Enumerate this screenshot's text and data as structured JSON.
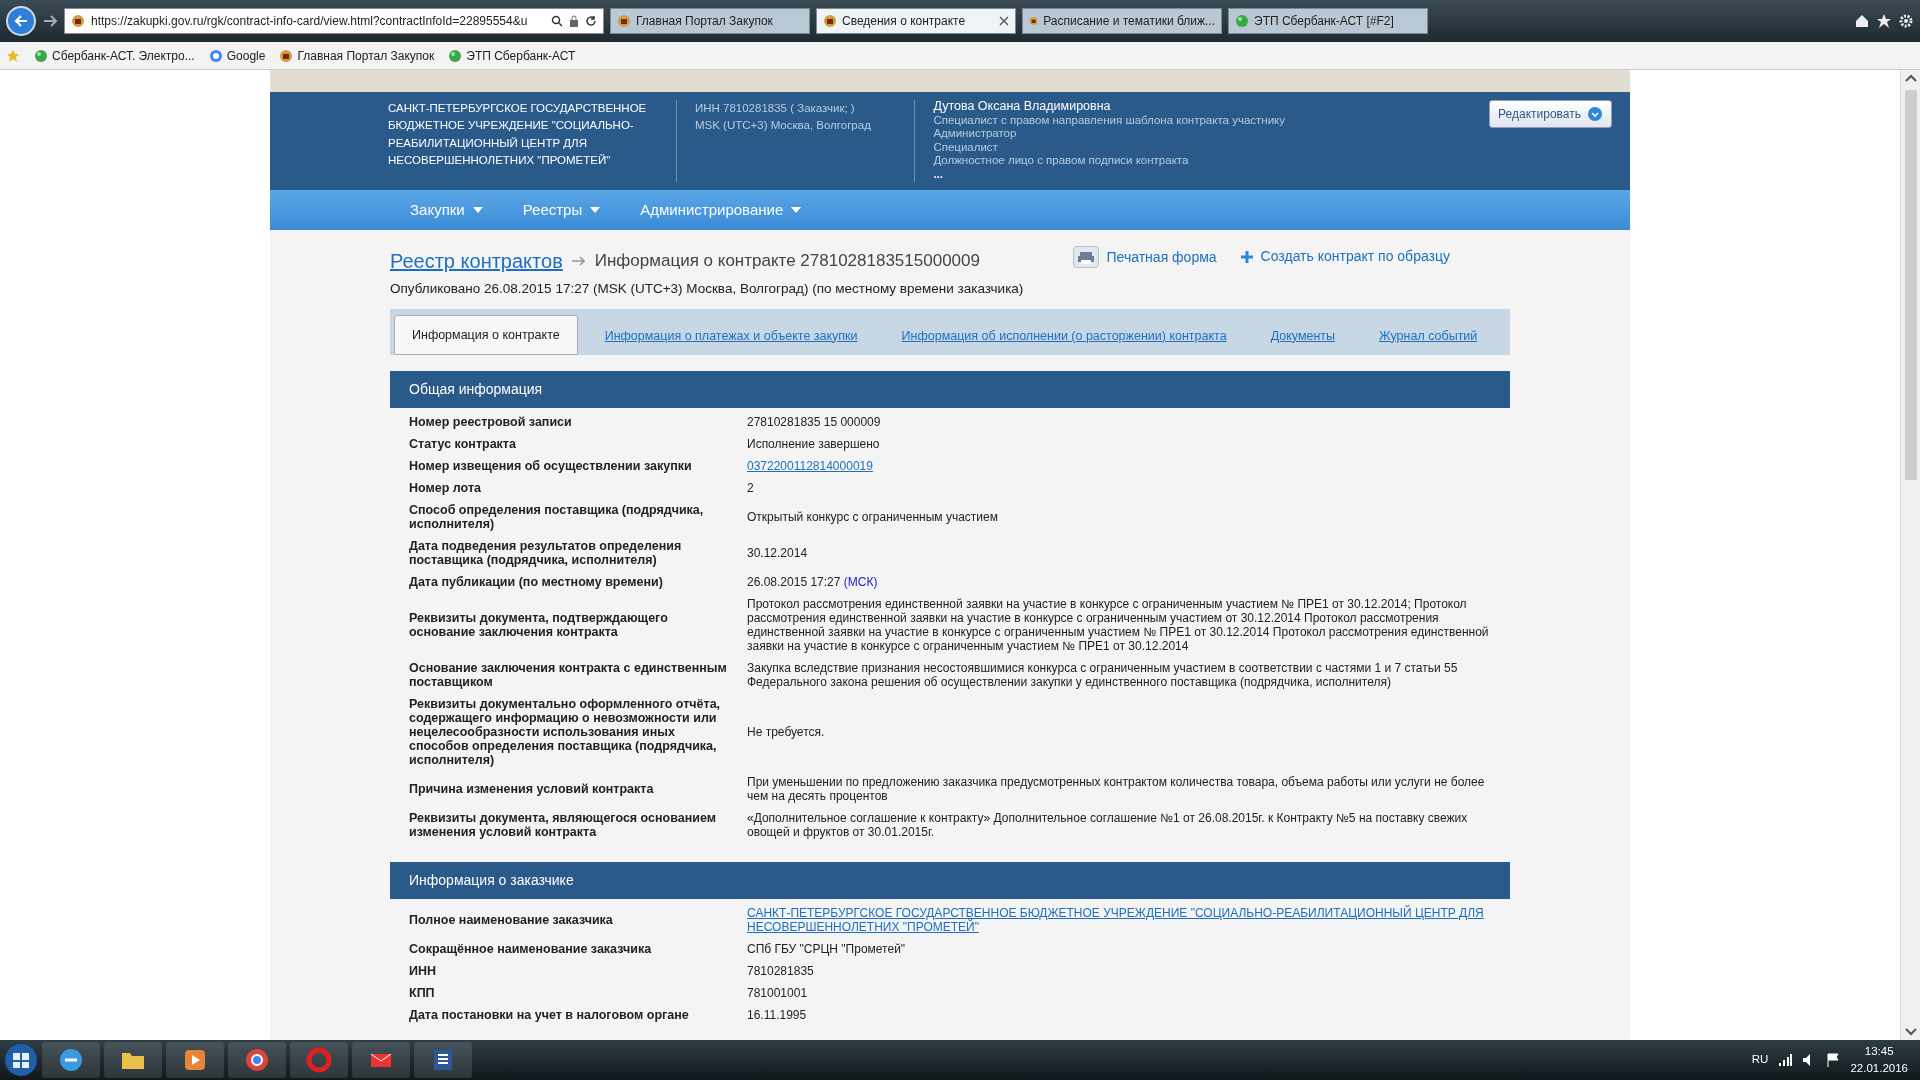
{
  "browser": {
    "url": "https://zakupki.gov.ru/rgk/contract-info-card/view.html?contractInfoId=22895554&u",
    "tabs": [
      {
        "title": "Главная Портал Закупок",
        "selected": false
      },
      {
        "title": "Сведения о контракте",
        "selected": true
      },
      {
        "title": "Расписание и тематики ближ...",
        "selected": false
      },
      {
        "title": "ЭТП Сбербанк-АСТ [#F2]",
        "selected": false
      }
    ],
    "favorites": [
      "Сбербанк-АСТ. Электро...",
      "Google",
      "Главная Портал Закупок",
      "ЭТП Сбербанк-АСТ"
    ]
  },
  "header": {
    "org": "САНКТ-ПЕТЕРБУРГСКОЕ ГОСУДАРСТВЕННОЕ БЮДЖЕТНОЕ УЧРЕЖДЕНИЕ \"СОЦИАЛЬНО-РЕАБИЛИТАЦИОННЫЙ ЦЕНТР ДЛЯ НЕСОВЕРШЕННОЛЕТНИХ \"ПРОМЕТЕЙ\"",
    "inn": "ИНН 7810281835 ( Заказчик; )",
    "timezone": "MSK (UTC+3) Москва, Волгоград",
    "user": "Дутова Оксана Владимировна",
    "roles": [
      "Специалист с правом направления шаблона контракта участнику",
      "Администратор",
      "Специалист",
      "Должностное лицо с правом подписи контракта"
    ],
    "more": "...",
    "edit_button": "Редактировать"
  },
  "nav": [
    "Закупки",
    "Реестры",
    "Администрирование"
  ],
  "breadcrumb": {
    "link": "Реестр контрактов",
    "current": "Информация о контракте 2781028183515000009"
  },
  "published": "Опубликовано 26.08.2015 17:27 (MSK (UTC+3) Москва, Волгоград) (по местному времени заказчика)",
  "actions": [
    {
      "kind": "print",
      "label": "Печатная форма"
    },
    {
      "kind": "create",
      "label": "Создать контракт по образцу"
    }
  ],
  "tabs": [
    {
      "label": "Информация о контракте",
      "selected": true
    },
    {
      "label": "Информация о платежах и объекте закупки",
      "selected": false
    },
    {
      "label": "Информация об исполнении (о расторжении) контракта",
      "selected": false
    },
    {
      "label": "Документы",
      "selected": false
    },
    {
      "label": "Журнал событий",
      "selected": false
    }
  ],
  "sections": [
    {
      "title": "Общая информация",
      "rows": [
        {
          "label": "Номер реестровой записи",
          "kind": "text",
          "value": "27810281835 15 000009"
        },
        {
          "label": "Статус контракта",
          "kind": "text",
          "value": "Исполнение завершено"
        },
        {
          "label": "Номер извещения об осуществлении закупки",
          "kind": "link",
          "value": "0372200112814000019"
        },
        {
          "label": "Номер лота",
          "kind": "text",
          "value": "2"
        },
        {
          "label": "Способ определения поставщика (подрядчика, исполнителя)",
          "kind": "text",
          "value": "Открытый конкурс с ограниченным участием"
        },
        {
          "label": "Дата подведения результатов определения поставщика (подрядчика, исполнителя)",
          "kind": "text",
          "value": "30.12.2014"
        },
        {
          "label": "Дата публикации (по местному времени)",
          "kind": "time",
          "value": "26.08.2015 17:27",
          "zone": "(МСК)"
        },
        {
          "label": "Реквизиты документа, подтверждающего основание заключения контракта",
          "kind": "text",
          "value": "Протокол рассмотрения единственной заявки на участие в конкурсе с ограниченным участием № ПРЕ1 от 30.12.2014; Протокол рассмотрения единственной заявки на участие в конкурсе с ограниченным участием от 30.12.2014 Протокол рассмотрения единственной заявки на участие в конкурсе с ограниченным участием № ПРЕ1 от 30.12.2014 Протокол рассмотрения единственной заявки на участие в конкурсе с ограниченным участием № ПРЕ1 от 30.12.2014"
        },
        {
          "label": "Основание заключения контракта с единственным поставщиком",
          "kind": "text",
          "value": "Закупка вследствие признания несостоявшимися конкурса с ограниченным участием в соответствии с частями 1 и 7 статьи 55 Федерального закона решения об осуществлении закупки у единственного поставщика (подрядчика, исполнителя)"
        },
        {
          "label": "Реквизиты документально оформленного отчёта, содержащего информацию о невозможности или нецелесообразности использования иных способов определения поставщика (подрядчика, исполнителя)",
          "kind": "text",
          "value": "Не требуется."
        },
        {
          "label": "Причина изменения условий контракта",
          "kind": "text",
          "value": "При уменьшении по предложению заказчика предусмотренных контрактом количества товара, объема работы или услуги не более чем на десять процентов"
        },
        {
          "label": "Реквизиты документа, являющегося основанием изменения условий контракта",
          "kind": "text",
          "value": "«Дополнительное соглашение к контракту» Дополнительное соглашение №1 от 26.08.2015г. к Контракту №5 на поставку свежих овощей и фруктов от 30.01.2015г."
        }
      ]
    },
    {
      "title": "Информация о заказчике",
      "rows": [
        {
          "label": "Полное наименование заказчика",
          "kind": "link",
          "value": "САНКТ-ПЕТЕРБУРГСКОЕ ГОСУДАРСТВЕННОЕ БЮДЖЕТНОЕ УЧРЕЖДЕНИЕ \"СОЦИАЛЬНО-РЕАБИЛИТАЦИОННЫЙ ЦЕНТР ДЛЯ НЕСОВЕРШЕННОЛЕТНИХ \"ПРОМЕТЕЙ\""
        },
        {
          "label": "Сокращённое наименование заказчика",
          "kind": "text",
          "value": "СПб ГБУ \"СРЦН \"Прометей\""
        },
        {
          "label": "ИНН",
          "kind": "text",
          "value": "7810281835"
        },
        {
          "label": "КПП",
          "kind": "text",
          "value": "781001001"
        },
        {
          "label": "Дата постановки на учет в налоговом органе",
          "kind": "text",
          "value": "16.11.1995"
        }
      ]
    }
  ],
  "taskbar": {
    "language": "RU",
    "time": "13:45",
    "date": "22.01.2016"
  }
}
